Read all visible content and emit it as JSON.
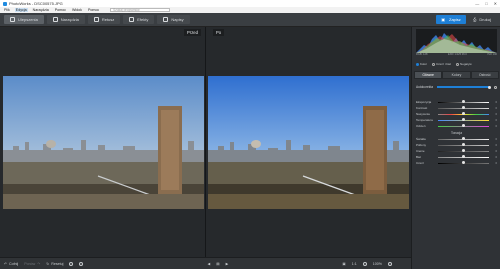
{
  "window": {
    "title": "PhotoWorks - DSC00575.JPG"
  },
  "menu": {
    "items": [
      "Plik",
      "Edycja",
      "Narzędzia",
      "Pomoc",
      "Widok",
      "Pomoc"
    ],
    "search_placeholder": "Szukaj programów"
  },
  "toolbar": {
    "tabs": [
      {
        "label": "Ulepszenia",
        "icon": "enhance-icon"
      },
      {
        "label": "Narzędzia",
        "icon": "tools-icon"
      },
      {
        "label": "Retusz",
        "icon": "brush-icon"
      },
      {
        "label": "Efekty",
        "icon": "effects-icon"
      },
      {
        "label": "Napisy",
        "icon": "text-icon"
      }
    ],
    "save_label": "Zapisz",
    "print_label": "Drukuj"
  },
  "compare": {
    "before_label": "Przed",
    "after_label": "Po"
  },
  "bottom": {
    "undo": "Cofnij",
    "redo": "Ponów",
    "reset": "Resetuj",
    "page": "1:1",
    "zoom": "100%"
  },
  "histogram": {
    "left_info": "RGB: 128",
    "mid_info": "EXIF 1/125 f/9.0",
    "right_info": "ISO 100"
  },
  "panel": {
    "radio_options": [
      "Kolor",
      "Czerń i biel",
      "Negatyw"
    ],
    "tabs": [
      "Główne",
      "Kolory",
      "Ostrość"
    ],
    "auto_label": "Autokorekta",
    "adjustments": [
      {
        "name": "Ekspozycja",
        "value": "0",
        "level": 0.5,
        "gradient": "linear-gradient(90deg,#000,#fff)"
      },
      {
        "name": "Kontrast",
        "value": "0",
        "level": 0.5,
        "gradient": "linear-gradient(90deg,#555,#ddd)"
      },
      {
        "name": "Nasycenie",
        "value": "0",
        "level": 0.5,
        "gradient": "linear-gradient(90deg,#888,#e44,#fd3,#4c4,#48f)"
      },
      {
        "name": "Temperatura",
        "value": "0",
        "level": 0.5,
        "gradient": "linear-gradient(90deg,#48f,#fd3)"
      },
      {
        "name": "Odcień",
        "value": "0",
        "level": 0.5,
        "gradient": "linear-gradient(90deg,#4c4,#d4d)"
      }
    ],
    "section_title": "Tonacja",
    "tone_adjustments": [
      {
        "name": "Światła",
        "value": "0",
        "level": 0.5,
        "gradient": "linear-gradient(90deg,#666,#eee)"
      },
      {
        "name": "Półtony",
        "value": "0",
        "level": 0.5,
        "gradient": "linear-gradient(90deg,#555,#ccc)"
      },
      {
        "name": "Cienie",
        "value": "0",
        "level": 0.5,
        "gradient": "linear-gradient(90deg,#222,#888)"
      },
      {
        "name": "Biel",
        "value": "0",
        "level": 0.5,
        "gradient": "linear-gradient(90deg,#888,#fff)"
      },
      {
        "name": "Czerń",
        "value": "0",
        "level": 0.5,
        "gradient": "linear-gradient(90deg,#000,#777)"
      }
    ]
  }
}
